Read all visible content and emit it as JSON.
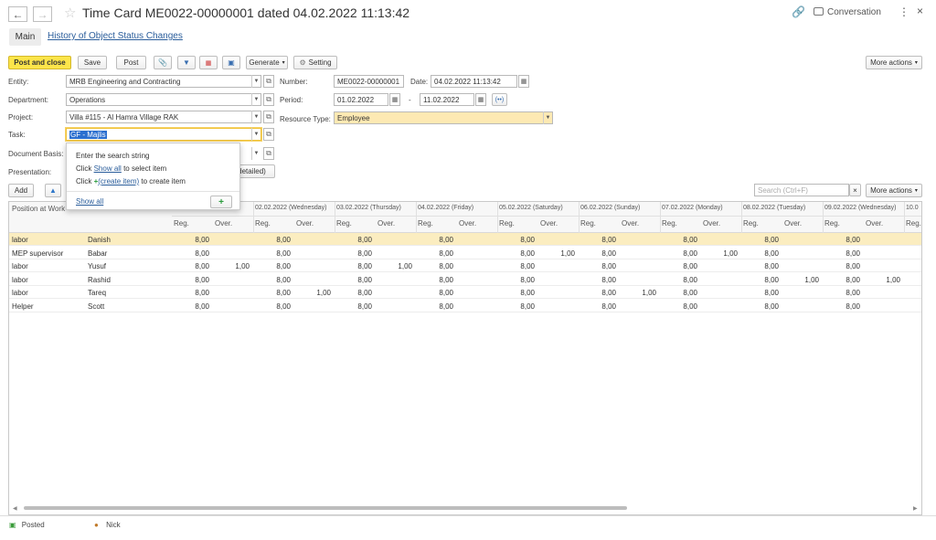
{
  "header": {
    "title": "Time Card ME0022-00000001 dated 04.02.2022 11:13:42",
    "conversation_label": "Conversation"
  },
  "tabs": {
    "main": "Main",
    "history": "History of Object Status Changes"
  },
  "toolbar": {
    "post_and_close": "Post and close",
    "save": "Save",
    "post": "Post",
    "generate": "Generate",
    "setting": "Setting",
    "more_actions": "More actions"
  },
  "form": {
    "entity_label": "Entity:",
    "entity_value": "MRB Engineering and Contracting",
    "number_label": "Number:",
    "number_value": "ME0022-00000001",
    "date_label": "Date:",
    "date_value": "04.02.2022 11:13:42",
    "department_label": "Department:",
    "department_value": "Operations",
    "period_label": "Period:",
    "period_from": "01.02.2022",
    "period_sep": "-",
    "period_to": "11.02.2022",
    "project_label": "Project:",
    "project_value": "Villa #115 - Al Hamra Village RAK",
    "resource_type_label": "Resource Type:",
    "resource_type_value": "Employee",
    "task_label": "Task:",
    "task_value": "GF - Majlis",
    "document_basis_label": "Document Basis:",
    "presentation_label": "Presentation:",
    "presentation_btn_fragment": "detailed)"
  },
  "popup": {
    "line1": "Enter the search string",
    "line2_pre": "Click",
    "line2_link": "Show all",
    "line2_post": "to select item",
    "line3_pre": "Click",
    "line3_link": "(create item)",
    "line3_post": "to create item",
    "show_all": "Show all",
    "plus": "+"
  },
  "table_toolbar": {
    "add": "Add",
    "search_placeholder": "Search (Ctrl+F)",
    "more_actions": "More actions"
  },
  "table": {
    "col_position": "Position at Work",
    "reg": "Reg.",
    "over": "Over.",
    "days": [
      "",
      "",
      "02.02.2022 (Wednesday)",
      "03.02.2022 (Thursday)",
      "04.02.2022 (Friday)",
      "05.02.2022 (Saturday)",
      "06.02.2022 (Sunday)",
      "07.02.2022 (Monday)",
      "08.02.2022 (Tuesday)",
      "09.02.2022 (Wednesday)",
      "10.0"
    ],
    "rows": [
      {
        "position": "labor",
        "name": "Danish",
        "vals": [
          "8,00",
          "",
          "8,00",
          "",
          "8,00",
          "",
          "8,00",
          "",
          "8,00",
          "",
          "8,00",
          "",
          "8,00",
          "",
          "8,00",
          "",
          "8,00",
          ""
        ]
      },
      {
        "position": "MEP supervisor",
        "name": "Babar",
        "vals": [
          "8,00",
          "",
          "8,00",
          "",
          "8,00",
          "",
          "8,00",
          "",
          "8,00",
          "1,00",
          "8,00",
          "",
          "8,00",
          "1,00",
          "8,00",
          "",
          "8,00",
          ""
        ]
      },
      {
        "position": "labor",
        "name": "Yusuf",
        "vals": [
          "8,00",
          "1,00",
          "8,00",
          "",
          "8,00",
          "1,00",
          "8,00",
          "",
          "8,00",
          "",
          "8,00",
          "",
          "8,00",
          "",
          "8,00",
          "",
          "8,00",
          ""
        ]
      },
      {
        "position": "labor",
        "name": "Rashid",
        "vals": [
          "8,00",
          "",
          "8,00",
          "",
          "8,00",
          "",
          "8,00",
          "",
          "8,00",
          "",
          "8,00",
          "",
          "8,00",
          "",
          "8,00",
          "1,00",
          "8,00",
          "1,00"
        ]
      },
      {
        "position": "labor",
        "name": "Tareq",
        "vals": [
          "8,00",
          "",
          "8,00",
          "1,00",
          "8,00",
          "",
          "8,00",
          "",
          "8,00",
          "",
          "8,00",
          "1,00",
          "8,00",
          "",
          "8,00",
          "",
          "8,00",
          ""
        ]
      },
      {
        "position": "Helper",
        "name": "Scott",
        "vals": [
          "8,00",
          "",
          "8,00",
          "",
          "8,00",
          "",
          "8,00",
          "",
          "8,00",
          "",
          "8,00",
          "",
          "8,00",
          "",
          "8,00",
          "",
          "8,00",
          ""
        ]
      }
    ]
  },
  "status_bar": {
    "posted": "Posted",
    "user": "Nick"
  },
  "colors": {
    "primary_button": "#fce54a",
    "selected_row": "#fbedc0",
    "link": "#2a5d9b",
    "highlight_field": "#fde9b3"
  }
}
